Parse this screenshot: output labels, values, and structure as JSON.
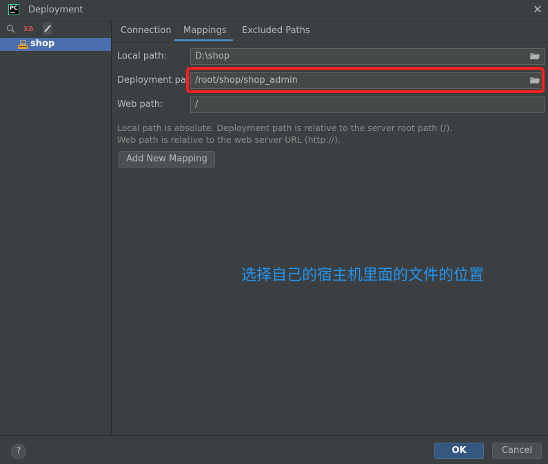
{
  "window": {
    "title": "Deployment",
    "close_glyph": "✕",
    "app_logo_text": "PC"
  },
  "sidebar": {
    "search_value": "xa",
    "items": [
      {
        "label": "shop",
        "icon": "sftp-icon"
      }
    ]
  },
  "tabs": [
    {
      "label": "Connection",
      "active": false
    },
    {
      "label": "Mappings",
      "active": true
    },
    {
      "label": "Excluded Paths",
      "active": false
    }
  ],
  "form": {
    "local_path": {
      "label": "Local path:",
      "value": "D:\\shop"
    },
    "deployment_path": {
      "label": "Deployment path:",
      "value": "/root/shop/shop_admin"
    },
    "web_path": {
      "label": "Web path:",
      "value": "/"
    }
  },
  "help": {
    "line1": "Local path is absolute. Deployment path is relative to the server root path (/).",
    "line2": "Web path is relative to the web server URL (http://)."
  },
  "add_mapping_label": "Add New Mapping",
  "annotation_text": "选择自己的宿主机里面的文件的位置",
  "footer": {
    "help_glyph": "?",
    "ok_label": "OK",
    "cancel_label": "Cancel"
  },
  "colors": {
    "highlight": "#ff1f1f",
    "accent": "#4a88c7",
    "annotation": "#2196f3",
    "selection": "#4b6eaf"
  }
}
